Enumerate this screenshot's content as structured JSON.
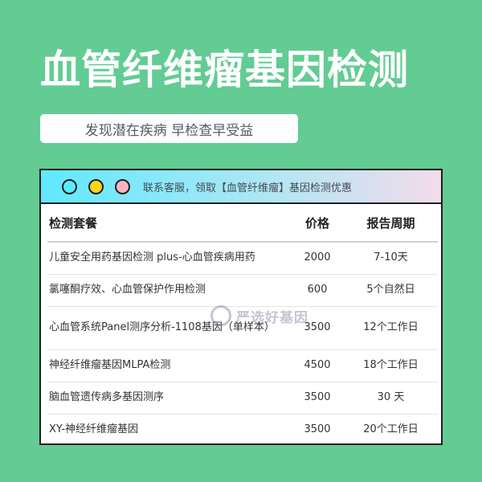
{
  "title": "血管纤维瘤基因检测",
  "subtitle": "发现潜在疾病 早检查早受益",
  "window": {
    "dot_colors": [
      "#5fe9ff",
      "#ffd21f",
      "#ffb3c1"
    ],
    "bar_text": "联系客服，领取【血管纤维瘤】基因检测优惠"
  },
  "table": {
    "headers": {
      "name": "检测套餐",
      "price": "价格",
      "period": "报告周期"
    },
    "rows": [
      {
        "name": "儿童安全用药基因检测 plus-心血管疾病用药",
        "price": "2000",
        "period": "7-10天"
      },
      {
        "name": "氯噻酮疗效、心血管保护作用检测",
        "price": "600",
        "period": "5个自然日"
      },
      {
        "name": "心血管系统Panel测序分析-1108基因（单样本）",
        "price": "3500",
        "period": "12个工作日"
      },
      {
        "name": "神经纤维瘤基因MLPA检测",
        "price": "4500",
        "period": "18个工作日"
      },
      {
        "name": "脑血管遗传病多基因测序",
        "price": "3500",
        "period": "30 天"
      },
      {
        "name": "XY-神经纤维瘤基因",
        "price": "3500",
        "period": "20个工作日"
      }
    ]
  },
  "watermark": "严选好基因"
}
